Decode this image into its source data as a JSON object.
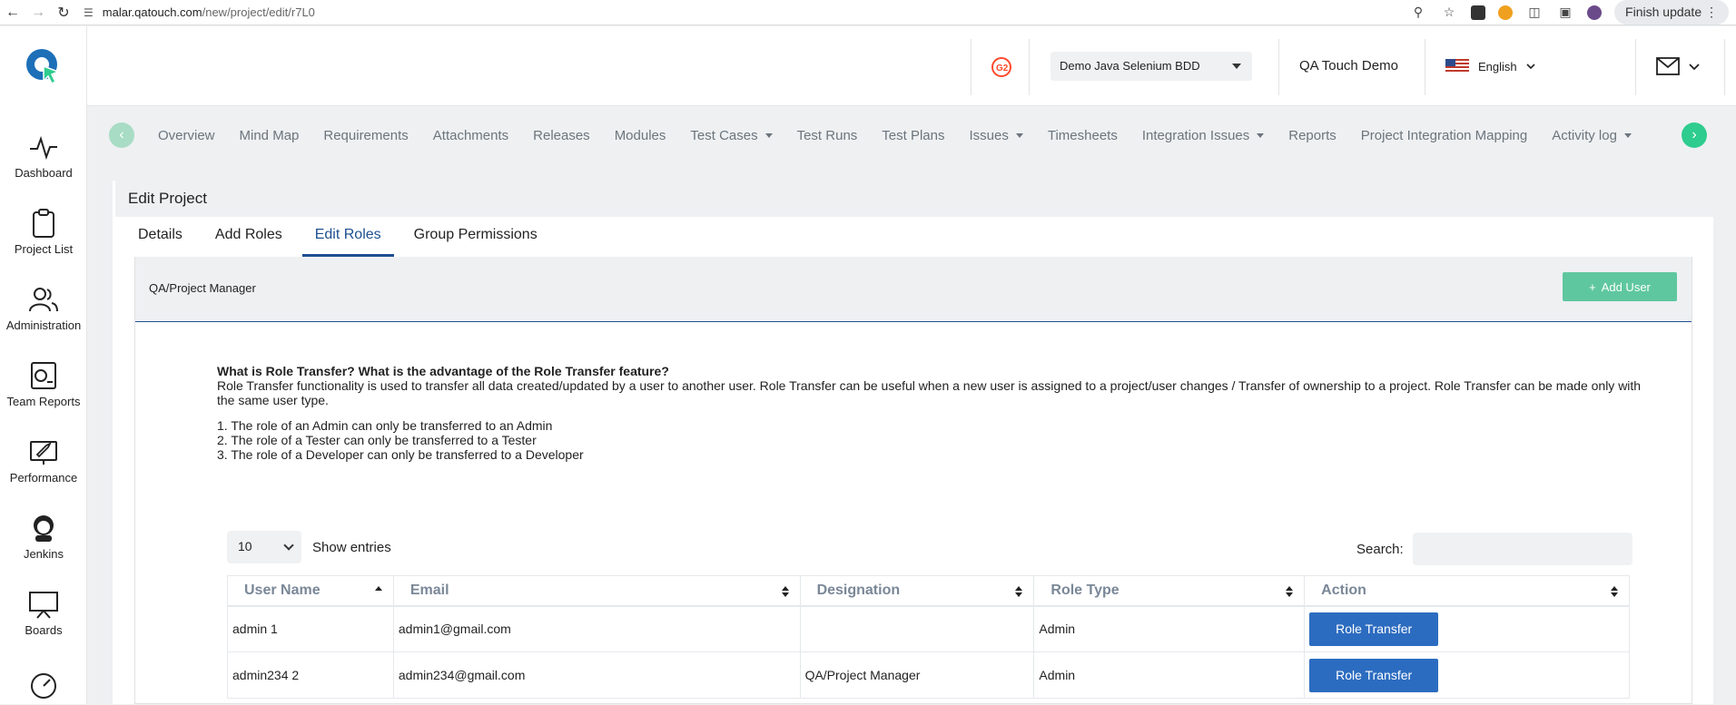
{
  "browser": {
    "url_domain": "malar.qatouch.com",
    "url_path": "/new/project/edit/r7L0",
    "update_label": "Finish update"
  },
  "sidebar": {
    "items": [
      {
        "label": "Dashboard",
        "icon": "pulse-icon"
      },
      {
        "label": "Project List",
        "icon": "clipboard-icon"
      },
      {
        "label": "Administration",
        "icon": "users-icon"
      },
      {
        "label": "Team Reports",
        "icon": "report-icon"
      },
      {
        "label": "Performance",
        "icon": "performance-icon"
      },
      {
        "label": "Jenkins",
        "icon": "jenkins-icon"
      },
      {
        "label": "Boards",
        "icon": "board-icon"
      }
    ]
  },
  "header": {
    "project_select": "Demo Java Selenium BDD",
    "company": "QA Touch Demo",
    "language": "English"
  },
  "project_nav": {
    "links": [
      {
        "label": "Overview",
        "dropdown": false
      },
      {
        "label": "Mind Map",
        "dropdown": false
      },
      {
        "label": "Requirements",
        "dropdown": false
      },
      {
        "label": "Attachments",
        "dropdown": false
      },
      {
        "label": "Releases",
        "dropdown": false
      },
      {
        "label": "Modules",
        "dropdown": false
      },
      {
        "label": "Test Cases",
        "dropdown": true
      },
      {
        "label": "Test Runs",
        "dropdown": false
      },
      {
        "label": "Test Plans",
        "dropdown": false
      },
      {
        "label": "Issues",
        "dropdown": true
      },
      {
        "label": "Timesheets",
        "dropdown": false
      },
      {
        "label": "Integration Issues",
        "dropdown": true
      },
      {
        "label": "Reports",
        "dropdown": false
      },
      {
        "label": "Project Integration Mapping",
        "dropdown": false
      },
      {
        "label": "Activity log",
        "dropdown": true
      }
    ]
  },
  "page": {
    "title": "Edit Project",
    "tabs": [
      "Details",
      "Add Roles",
      "Edit Roles",
      "Group Permissions"
    ],
    "active_tab": "Edit Roles",
    "role_title": "QA/Project Manager",
    "add_user_label": "Add User",
    "info": {
      "question": "What is Role Transfer? What is the advantage of the Role Transfer feature?",
      "description": "Role Transfer functionality is used to transfer all data created/updated by a user to another user. Role Transfer can be useful when a new user is assigned to a project/user changes / Transfer of ownership to a project. Role Transfer can be made only with the same user type.",
      "rules": [
        "1. The role of an Admin can only be transferred to an Admin",
        "2. The role of a Tester can only be transferred to a Tester",
        "3. The role of a Developer can only be transferred to a Developer"
      ]
    },
    "entries_value": "10",
    "entries_label": "Show entries",
    "search_label": "Search:",
    "table": {
      "columns": [
        "User Name",
        "Email",
        "Designation",
        "Role Type",
        "Action"
      ],
      "rows": [
        {
          "user": "admin 1",
          "email": "admin1@gmail.com",
          "designation": "",
          "role": "Admin",
          "action": "Role Transfer"
        },
        {
          "user": "admin234 2",
          "email": "admin234@gmail.com",
          "designation": "QA/Project Manager",
          "role": "Admin",
          "action": "Role Transfer"
        }
      ]
    }
  },
  "colors": {
    "primary": "#1d4f91",
    "accent_green": "#5fc79f",
    "button_blue": "#2c6cc0"
  }
}
